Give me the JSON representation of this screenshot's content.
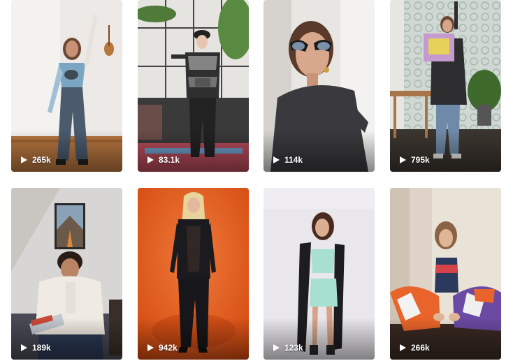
{
  "videos": [
    {
      "views": "265k"
    },
    {
      "views": "83.1k"
    },
    {
      "views": "114k"
    },
    {
      "views": "795k"
    },
    {
      "views": "189k"
    },
    {
      "views": "942k"
    },
    {
      "views": "123k"
    },
    {
      "views": "266k"
    }
  ],
  "icons": {
    "play": "play-icon"
  },
  "colors": {
    "views_text": "#ffffff",
    "background": "#ffffff",
    "orange_backdrop": "#e8581a"
  }
}
